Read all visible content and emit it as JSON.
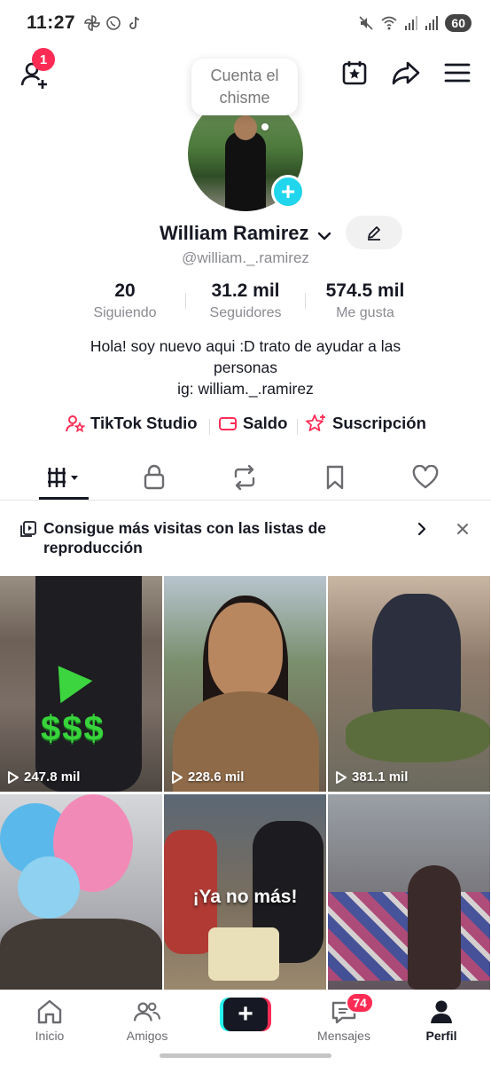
{
  "status_bar": {
    "time": "11:27",
    "battery": "60"
  },
  "header": {
    "notification_count": "1",
    "bubble_text": "Cuenta el chisme"
  },
  "profile": {
    "display_name": "William Ramirez",
    "username": "@william._.ramirez",
    "stats": [
      {
        "value": "20",
        "label": "Siguiendo"
      },
      {
        "value": "31.2 mil",
        "label": "Seguidores"
      },
      {
        "value": "574.5 mil",
        "label": "Me gusta"
      }
    ],
    "bio": [
      "Hola! soy nuevo aqui :D trato de ayudar a las",
      "personas",
      "ig: william._.ramirez"
    ]
  },
  "links": [
    {
      "label": "TikTok Studio",
      "icon": "person-star-icon"
    },
    {
      "label": "Saldo",
      "icon": "wallet-icon"
    },
    {
      "label": "Suscripción",
      "icon": "star-plus-icon"
    }
  ],
  "tabs": [
    {
      "icon": "grid-icon",
      "active": true
    },
    {
      "icon": "lock-icon"
    },
    {
      "icon": "repost-icon"
    },
    {
      "icon": "bookmark-icon"
    },
    {
      "icon": "heart-icon"
    }
  ],
  "playlist_banner": {
    "text": "Consigue más visitas con las listas de reproducción"
  },
  "videos": [
    {
      "views": "247.8 mil"
    },
    {
      "views": "228.6 mil"
    },
    {
      "views": "381.1 mil"
    },
    {
      "views": ""
    },
    {
      "views": "",
      "caption": "¡Ya no más!"
    },
    {
      "views": ""
    }
  ],
  "bottom_nav": {
    "items": [
      {
        "label": "Inicio",
        "icon": "home-icon"
      },
      {
        "label": "Amigos",
        "icon": "friends-icon"
      },
      {
        "label": "Mensajes",
        "icon": "messages-icon"
      },
      {
        "label": "Perfil",
        "icon": "profile-icon",
        "active": true
      }
    ],
    "messages_badge": "74"
  },
  "colors": {
    "accent": "#fe2c55",
    "cyan": "#20d5ec"
  }
}
